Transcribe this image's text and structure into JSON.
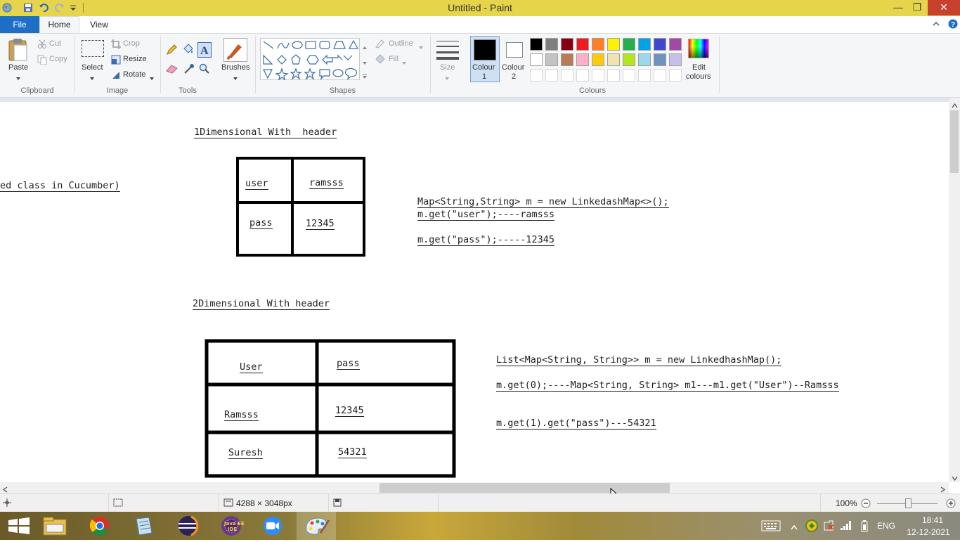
{
  "window": {
    "title": "Untitled - Paint"
  },
  "tabs": [
    {
      "label": "File"
    },
    {
      "label": "Home"
    },
    {
      "label": "View"
    }
  ],
  "ribbon": {
    "clipboard": {
      "group": "Clipboard",
      "paste": "Paste",
      "cut": "Cut",
      "copy": "Copy"
    },
    "image": {
      "group": "Image",
      "select": "Select",
      "crop": "Crop",
      "resize": "Resize",
      "rotate": "Rotate"
    },
    "tools": {
      "group": "Tools"
    },
    "brushes": {
      "label": "Brushes"
    },
    "shapes": {
      "group": "Shapes",
      "outline": "Outline",
      "fill": "Fill"
    },
    "size": {
      "label": "Size"
    },
    "colour1": {
      "line1": "Colour",
      "line2": "1"
    },
    "colour2": {
      "line1": "Colour",
      "line2": "2"
    },
    "colours": {
      "group": "Colours",
      "edit_line1": "Edit",
      "edit_line2": "colours",
      "row1": [
        "#000000",
        "#7f7f7f",
        "#880015",
        "#ed1c24",
        "#ff7f27",
        "#fff200",
        "#22b14c",
        "#00a2e8",
        "#3f48cc",
        "#a349a4"
      ],
      "row2": [
        "#ffffff",
        "#c3c3c3",
        "#b97a57",
        "#ffaec9",
        "#ffc90e",
        "#efe4b0",
        "#b5e61d",
        "#99d9ea",
        "#7092be",
        "#c8bfe7"
      ]
    }
  },
  "canvas": {
    "section1_title": "1Dimensional With  header",
    "left_fragment": "ed class in Cucumber)",
    "table1": {
      "r1c1": "user",
      "r1c2": "ramsss",
      "r2c1": "pass",
      "r2c2": "12345"
    },
    "code1": {
      "line1": "Map<String,String> m = new LinkedashMap<>();",
      "line2": "m.get(\"user\");----ramsss",
      "line3": "m.get(\"pass\");-----12345"
    },
    "section2_title": "2Dimensional With header",
    "table2": {
      "h1": "User",
      "h2": "pass",
      "r1c1": "Ramsss",
      "r1c2": "12345",
      "r2c1": "Suresh",
      "r2c2": "54321"
    },
    "code2": {
      "line1": "List<Map<String, String>> m = new LinkedhashMap();",
      "line2": "m.get(0);----Map<String, String> m1---m1.get(\"User\")--Ramsss",
      "line3": "m.get(1).get(\"pass\")---54321"
    }
  },
  "statusbar": {
    "dimensions": "4288 × 3048px",
    "zoom": "100%"
  },
  "taskbar": {
    "language": "ENG",
    "time": "18:41",
    "date": "12-12-2021"
  }
}
